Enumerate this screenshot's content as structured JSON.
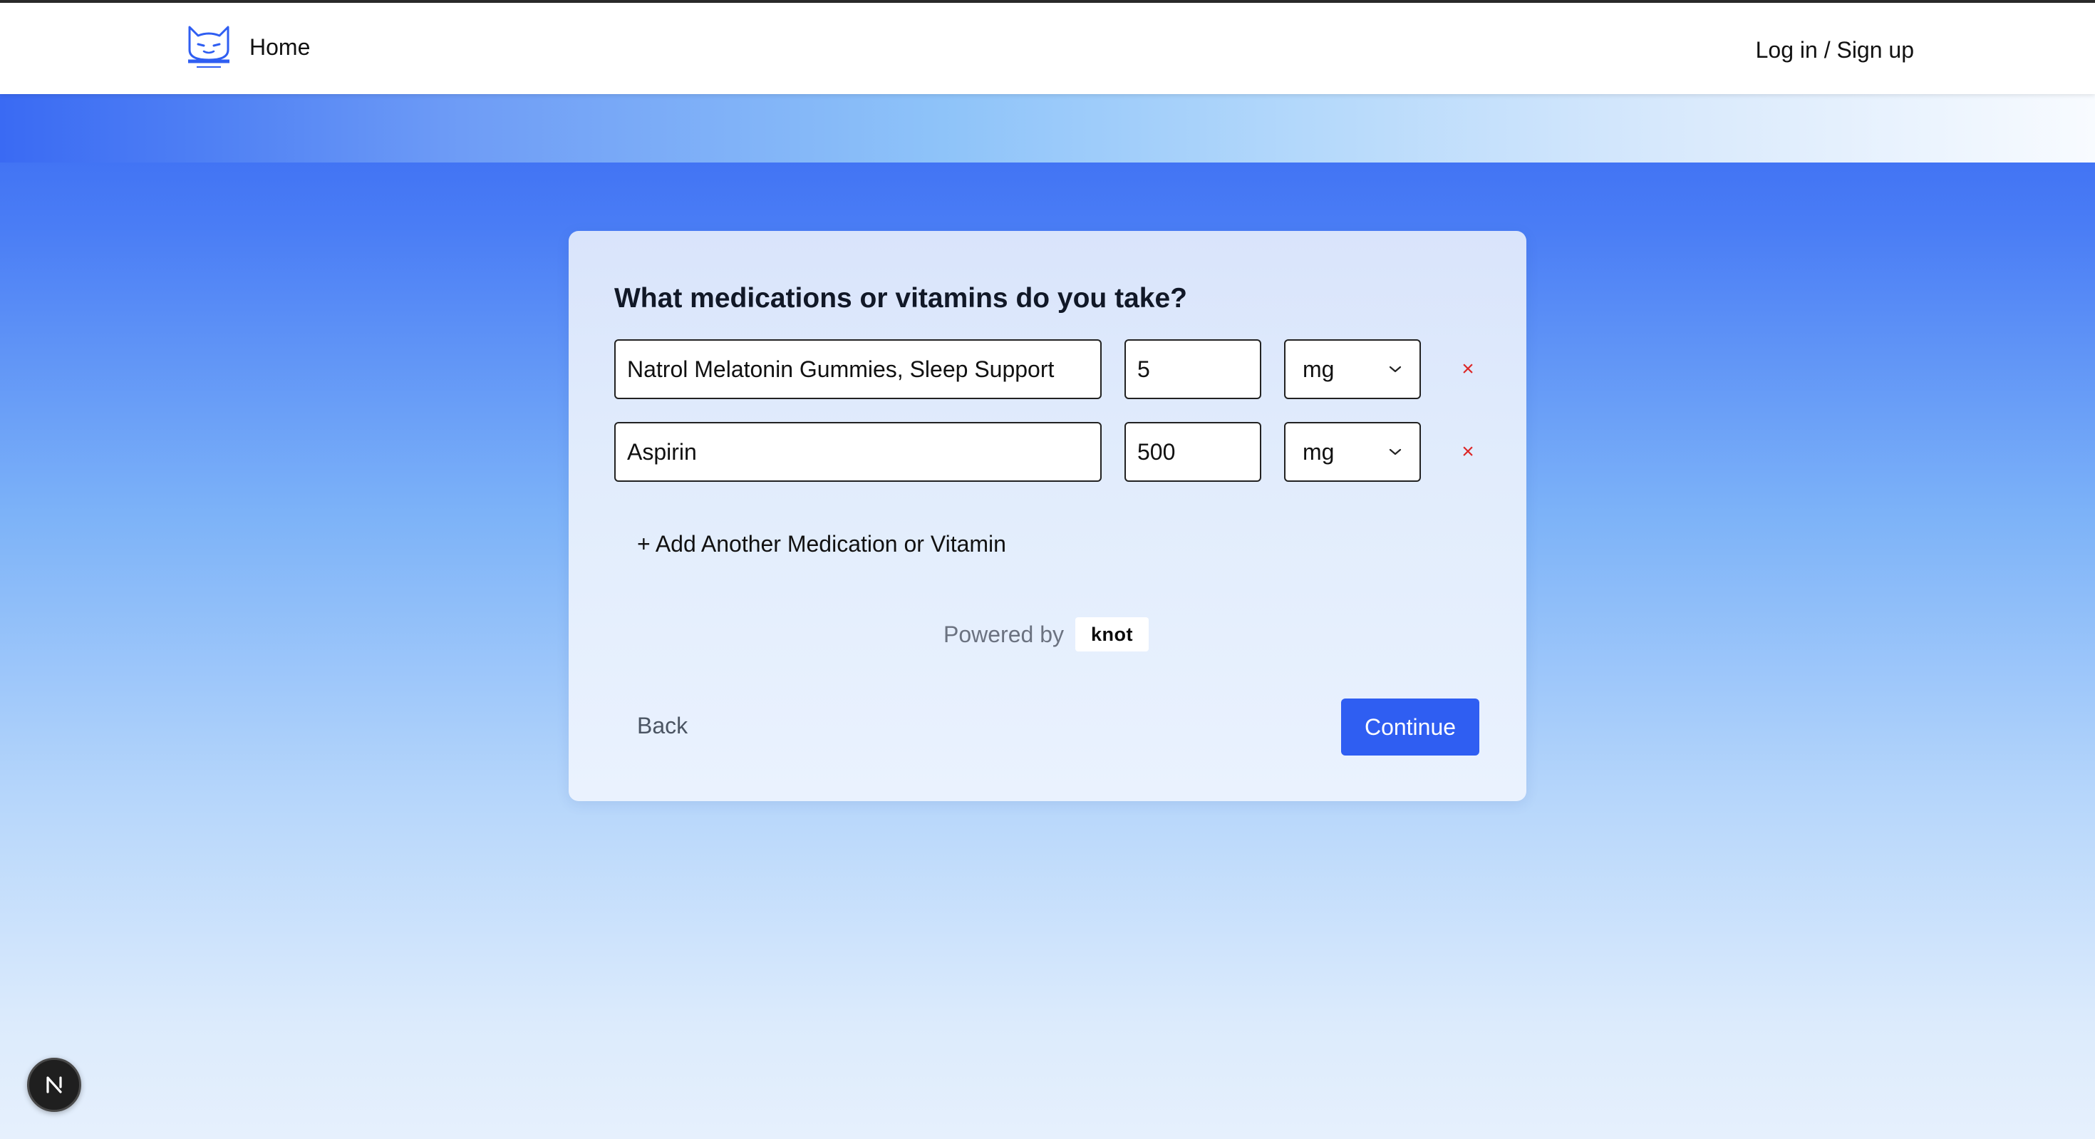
{
  "nav": {
    "home_label": "Home",
    "login_label": "Log in / Sign up",
    "logo_icon": "cat-logo-icon"
  },
  "form": {
    "title": "What medications or vitamins do you take?",
    "medications": [
      {
        "name": "Natrol Melatonin Gummies, Sleep Support",
        "dose": "5",
        "unit": "mg"
      },
      {
        "name": "Aspirin",
        "dose": "500",
        "unit": "mg"
      }
    ],
    "remove_label": "×",
    "add_label": "+ Add Another Medication or Vitamin",
    "powered_by": "Powered by",
    "powered_brand": "knot",
    "back_label": "Back",
    "continue_label": "Continue"
  },
  "fab": {
    "letter": "N",
    "icon": "nextjs-icon"
  },
  "colors": {
    "primary": "#2f5ef2",
    "remove": "#dc2626",
    "muted_text": "#6b7280"
  }
}
